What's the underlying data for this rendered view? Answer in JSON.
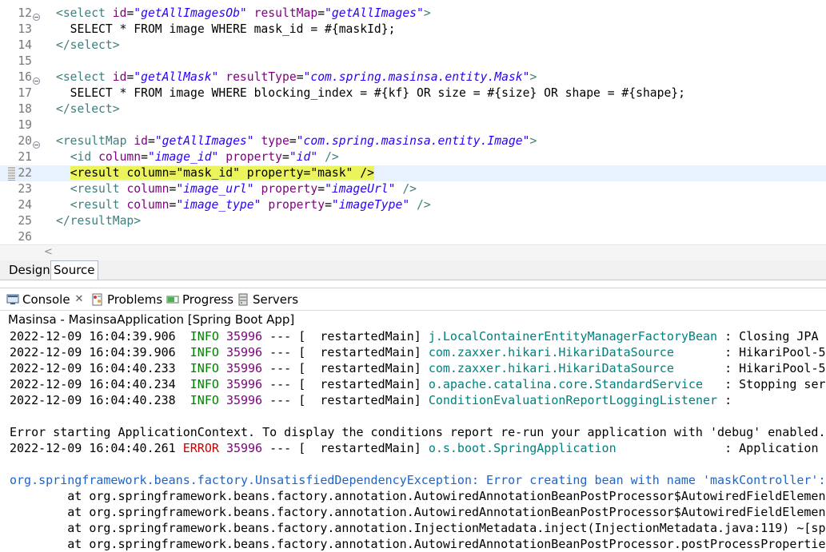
{
  "editor": {
    "lines": [
      {
        "n": "12",
        "fold": true,
        "segs": [
          [
            "tag",
            "<select "
          ],
          [
            "attr",
            "id"
          ],
          [
            "plain",
            "="
          ],
          [
            "val",
            "\"getAllImagesOb\""
          ],
          [
            "plain",
            " "
          ],
          [
            "attr",
            "resultMap"
          ],
          [
            "plain",
            "="
          ],
          [
            "val",
            "\"getAllImages\""
          ],
          [
            "tag",
            ">"
          ]
        ]
      },
      {
        "n": "13",
        "fold": false,
        "segs": [
          [
            "plain",
            "  SELECT * FROM image WHERE mask_id = #{maskId};"
          ]
        ]
      },
      {
        "n": "14",
        "fold": false,
        "segs": [
          [
            "tag",
            "</select>"
          ]
        ]
      },
      {
        "n": "15",
        "fold": false,
        "segs": []
      },
      {
        "n": "16",
        "fold": true,
        "segs": [
          [
            "tag",
            "<select "
          ],
          [
            "attr",
            "id"
          ],
          [
            "plain",
            "="
          ],
          [
            "val",
            "\"getAllMask\""
          ],
          [
            "plain",
            " "
          ],
          [
            "attr",
            "resultType"
          ],
          [
            "plain",
            "="
          ],
          [
            "val",
            "\"com.spring.masinsa.entity.Mask\""
          ],
          [
            "tag",
            ">"
          ]
        ]
      },
      {
        "n": "17",
        "fold": false,
        "segs": [
          [
            "plain",
            "  SELECT * FROM image WHERE blocking_index = #{kf} OR size = #{size} OR shape = #{shape};"
          ]
        ]
      },
      {
        "n": "18",
        "fold": false,
        "segs": [
          [
            "tag",
            "</select>"
          ]
        ]
      },
      {
        "n": "19",
        "fold": false,
        "segs": []
      },
      {
        "n": "20",
        "fold": true,
        "segs": [
          [
            "tag",
            "<resultMap "
          ],
          [
            "attr",
            "id"
          ],
          [
            "plain",
            "="
          ],
          [
            "val",
            "\"getAllImages\""
          ],
          [
            "plain",
            " "
          ],
          [
            "attr",
            "type"
          ],
          [
            "plain",
            "="
          ],
          [
            "val",
            "\"com.spring.masinsa.entity.Image\""
          ],
          [
            "tag",
            ">"
          ]
        ]
      },
      {
        "n": "21",
        "fold": false,
        "segs": [
          [
            "plain",
            "  "
          ],
          [
            "tag",
            "<id "
          ],
          [
            "attr",
            "column"
          ],
          [
            "plain",
            "="
          ],
          [
            "val",
            "\"image_id\""
          ],
          [
            "plain",
            " "
          ],
          [
            "attr",
            "property"
          ],
          [
            "plain",
            "="
          ],
          [
            "val",
            "\"id\""
          ],
          [
            "plain",
            " "
          ],
          [
            "tag",
            "/>"
          ]
        ]
      },
      {
        "n": "22",
        "fold": false,
        "current": true,
        "segs": [
          [
            "plain",
            "  "
          ],
          [
            "hl",
            "<result column=\"mask_id\" property=\"mask\" />"
          ]
        ]
      },
      {
        "n": "23",
        "fold": false,
        "segs": [
          [
            "plain",
            "  "
          ],
          [
            "tag",
            "<result "
          ],
          [
            "attr",
            "column"
          ],
          [
            "plain",
            "="
          ],
          [
            "val",
            "\"image_url\""
          ],
          [
            "plain",
            " "
          ],
          [
            "attr",
            "property"
          ],
          [
            "plain",
            "="
          ],
          [
            "val",
            "\"imageUrl\""
          ],
          [
            "plain",
            " "
          ],
          [
            "tag",
            "/>"
          ]
        ]
      },
      {
        "n": "24",
        "fold": false,
        "segs": [
          [
            "plain",
            "  "
          ],
          [
            "tag",
            "<result "
          ],
          [
            "attr",
            "column"
          ],
          [
            "plain",
            "="
          ],
          [
            "val",
            "\"image_type\""
          ],
          [
            "plain",
            " "
          ],
          [
            "attr",
            "property"
          ],
          [
            "plain",
            "="
          ],
          [
            "val",
            "\"imageType\""
          ],
          [
            "plain",
            " "
          ],
          [
            "tag",
            "/>"
          ]
        ]
      },
      {
        "n": "25",
        "fold": false,
        "segs": [
          [
            "tag",
            "</resultMap>"
          ]
        ]
      },
      {
        "n": "26",
        "fold": false,
        "segs": []
      }
    ],
    "scroll_arrow": "<"
  },
  "editor_tabs": {
    "design": "Design",
    "source": "Source"
  },
  "views": {
    "console": "Console",
    "console_close": "✕",
    "problems": "Problems",
    "progress": "Progress",
    "servers": "Servers"
  },
  "console": {
    "title": "Masinsa - MasinsaApplication [Spring Boot App]",
    "lines": [
      {
        "segs": [
          [
            "plain",
            "2022-12-09 16:04:39.906  "
          ],
          [
            "info",
            "INFO"
          ],
          [
            "plain",
            " "
          ],
          [
            "pid",
            "35996"
          ],
          [
            "plain",
            " --- [  restartedMain] "
          ],
          [
            "logger",
            "j.LocalContainerEntityManagerFactoryBean"
          ],
          [
            "plain",
            " : Closing JPA E"
          ]
        ]
      },
      {
        "segs": [
          [
            "plain",
            "2022-12-09 16:04:39.906  "
          ],
          [
            "info",
            "INFO"
          ],
          [
            "plain",
            " "
          ],
          [
            "pid",
            "35996"
          ],
          [
            "plain",
            " --- [  restartedMain] "
          ],
          [
            "logger",
            "com.zaxxer.hikari.HikariDataSource"
          ],
          [
            "plain",
            "       : HikariPool-5"
          ]
        ]
      },
      {
        "segs": [
          [
            "plain",
            "2022-12-09 16:04:40.233  "
          ],
          [
            "info",
            "INFO"
          ],
          [
            "plain",
            " "
          ],
          [
            "pid",
            "35996"
          ],
          [
            "plain",
            " --- [  restartedMain] "
          ],
          [
            "logger",
            "com.zaxxer.hikari.HikariDataSource"
          ],
          [
            "plain",
            "       : HikariPool-5"
          ]
        ]
      },
      {
        "segs": [
          [
            "plain",
            "2022-12-09 16:04:40.234  "
          ],
          [
            "info",
            "INFO"
          ],
          [
            "plain",
            " "
          ],
          [
            "pid",
            "35996"
          ],
          [
            "plain",
            " --- [  restartedMain] "
          ],
          [
            "logger",
            "o.apache.catalina.core.StandardService"
          ],
          [
            "plain",
            "   : Stopping serv"
          ]
        ]
      },
      {
        "segs": [
          [
            "plain",
            "2022-12-09 16:04:40.238  "
          ],
          [
            "info",
            "INFO"
          ],
          [
            "plain",
            " "
          ],
          [
            "pid",
            "35996"
          ],
          [
            "plain",
            " --- [  restartedMain] "
          ],
          [
            "logger",
            "ConditionEvaluationReportLoggingListener"
          ],
          [
            "plain",
            " :"
          ]
        ]
      },
      {
        "segs": []
      },
      {
        "segs": [
          [
            "plain",
            "Error starting ApplicationContext. To display the conditions report re-run your application with 'debug' enabled."
          ]
        ]
      },
      {
        "segs": [
          [
            "plain",
            "2022-12-09 16:04:40.261 "
          ],
          [
            "error",
            "ERROR"
          ],
          [
            "plain",
            " "
          ],
          [
            "pid",
            "35996"
          ],
          [
            "plain",
            " --- [  restartedMain] "
          ],
          [
            "logger",
            "o.s.boot.SpringApplication"
          ],
          [
            "plain",
            "               : Application r"
          ]
        ]
      },
      {
        "segs": []
      },
      {
        "segs": [
          [
            "exc",
            "org.springframework.beans.factory.UnsatisfiedDependencyException: Error creating bean with name 'maskController':"
          ]
        ]
      },
      {
        "segs": [
          [
            "plain",
            "        at org.springframework.beans.factory.annotation.AutowiredAnnotationBeanPostProcessor$AutowiredFieldElement"
          ]
        ]
      },
      {
        "segs": [
          [
            "plain",
            "        at org.springframework.beans.factory.annotation.AutowiredAnnotationBeanPostProcessor$AutowiredFieldElement"
          ]
        ]
      },
      {
        "segs": [
          [
            "plain",
            "        at org.springframework.beans.factory.annotation.InjectionMetadata.inject(InjectionMetadata.java:119) ~[spr"
          ]
        ]
      },
      {
        "segs": [
          [
            "plain",
            "        at org.springframework.beans.factory.annotation.AutowiredAnnotationBeanPostProcessor.postProcessProperties"
          ]
        ]
      }
    ]
  },
  "colors": {
    "tag": "#3f7f7f",
    "attr": "#7f007f",
    "value": "#2a00ff",
    "highlight": "#ecf45b",
    "info": "#008000",
    "error": "#c80000",
    "logger": "#008080",
    "exception": "#1e64c8"
  }
}
